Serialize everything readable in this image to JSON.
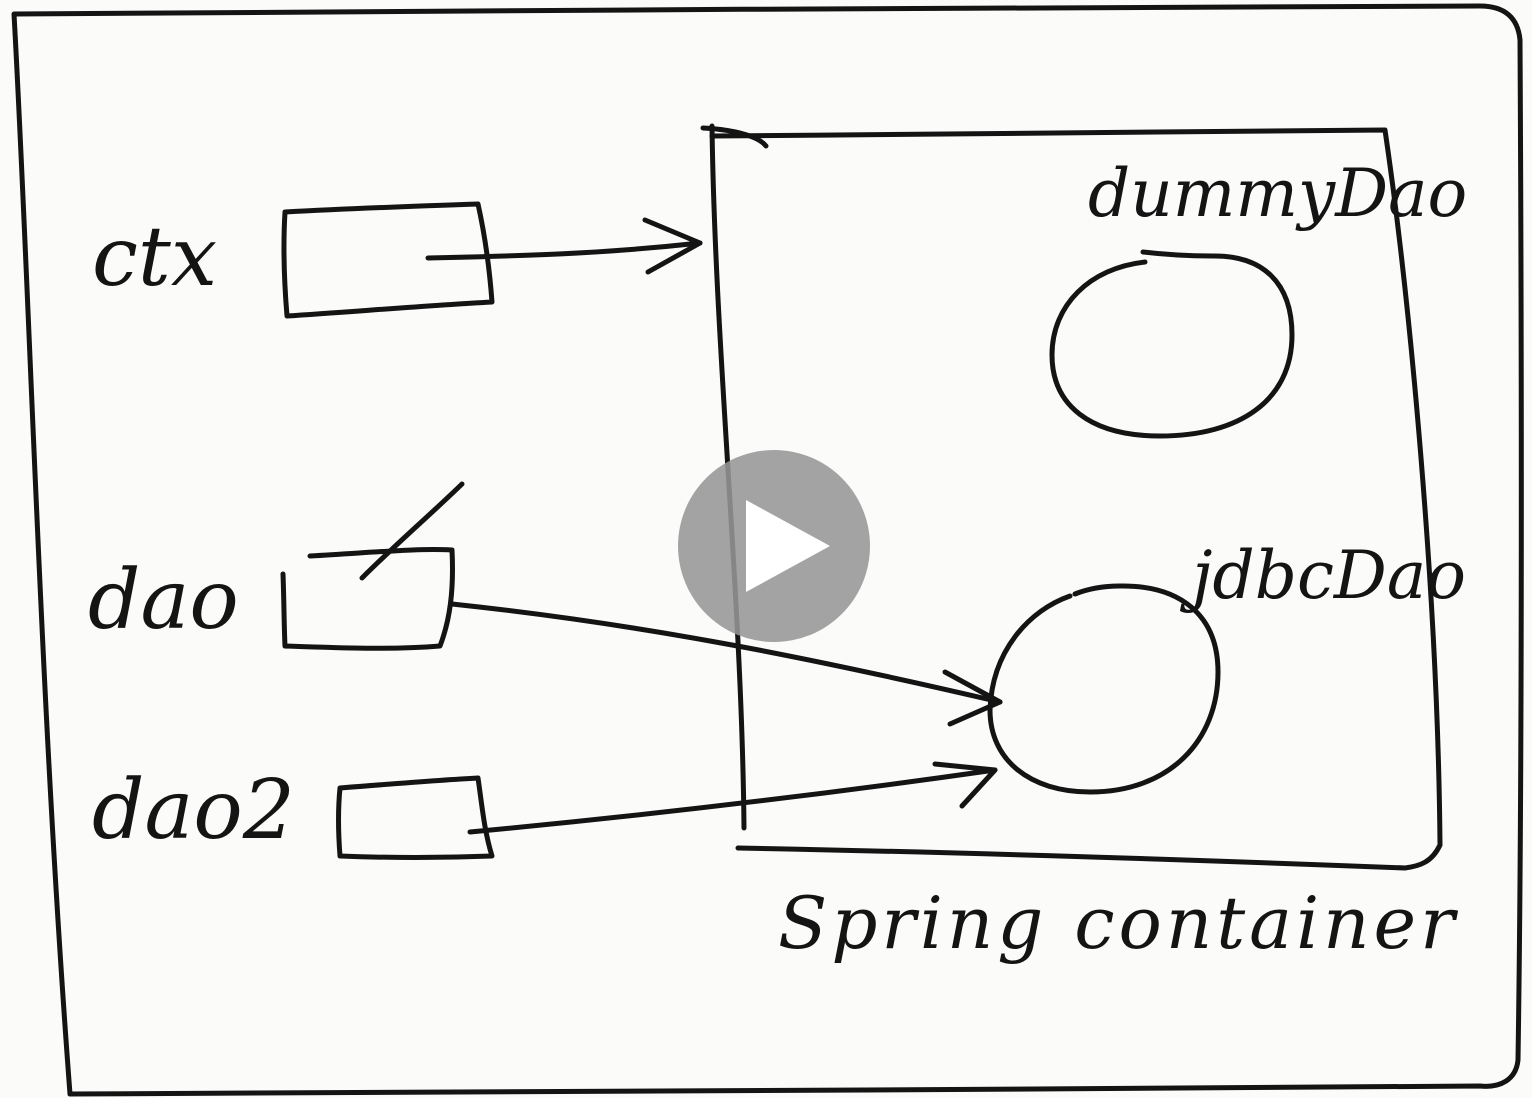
{
  "diagram": {
    "variables": [
      {
        "id": "ctx",
        "label": "ctx"
      },
      {
        "id": "dao",
        "label": "dao"
      },
      {
        "id": "dao2",
        "label": "dao2"
      }
    ],
    "beans": [
      {
        "id": "dummyDao",
        "label": "dummyDao"
      },
      {
        "id": "jdbcDao",
        "label": "jdbcDao"
      }
    ],
    "container_label": "Spring container",
    "references": [
      {
        "from": "ctx",
        "to": "Spring container"
      },
      {
        "from": "dao",
        "to": "jdbcDao"
      },
      {
        "from": "dao2",
        "to": "jdbcDao"
      }
    ],
    "crossed_out_reference": "dao"
  },
  "player": {
    "icon": "play-icon",
    "overlay_color": "#969696"
  }
}
